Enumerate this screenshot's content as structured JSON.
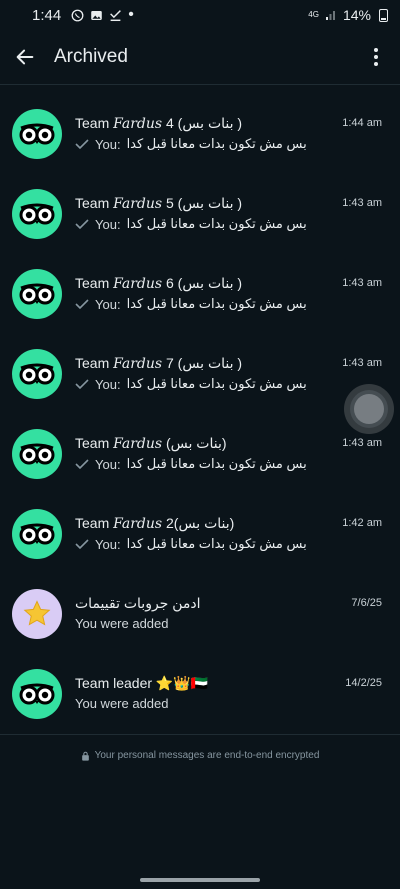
{
  "status_bar": {
    "time": "1:44",
    "network": "4G",
    "battery": "14%"
  },
  "header": {
    "title": "Archived"
  },
  "chats": [
    {
      "name_prefix": "Team ",
      "name_italic": "Fardus",
      "name_suffix": " 4 (بنات بس )",
      "time": "1:44 am",
      "you": "You:",
      "message": "بس مش تكون بدات معانا قبل كدا",
      "avatar": "owl-icon"
    },
    {
      "name_prefix": "Team ",
      "name_italic": "Fardus",
      "name_suffix": " 5 (بنات بس )",
      "time": "1:43 am",
      "you": "You:",
      "message": "بس مش تكون بدات معانا قبل كدا",
      "avatar": "owl-icon"
    },
    {
      "name_prefix": "Team ",
      "name_italic": "Fardus",
      "name_suffix": " 6 (بنات بس )",
      "time": "1:43 am",
      "you": "You:",
      "message": "بس مش تكون بدات معانا قبل كدا",
      "avatar": "owl-icon"
    },
    {
      "name_prefix": "Team ",
      "name_italic": "Fardus",
      "name_suffix": " 7 (بنات بس )",
      "time": "1:43 am",
      "you": "You:",
      "message": "بس مش تكون بدات معانا قبل كدا",
      "avatar": "owl-icon"
    },
    {
      "name_prefix": " Team ",
      "name_italic": "Fardus",
      "name_suffix": " (بنات بس)",
      "time": "1:43 am",
      "you": "You:",
      "message": "بس مش تكون بدات معانا قبل كدا",
      "avatar": "owl-icon"
    },
    {
      "name_prefix": "Team ",
      "name_italic": "Fardus",
      "name_suffix": " 2(بنات بس)",
      "time": "1:42 am",
      "you": "You:",
      "message": "بس مش تكون بدات معانا قبل كدا",
      "avatar": "owl-icon"
    }
  ],
  "chats_plain": [
    {
      "name": "ادمن جروبات تقييمات",
      "time": "7/6/25",
      "preview": "You were added",
      "avatar": "star-icon"
    },
    {
      "name": "Team leader ⭐👑🇦🇪",
      "time": "14/2/25",
      "preview": "You were added",
      "avatar": "owl-icon"
    }
  ],
  "footer": {
    "note": "Your personal messages are end-to-end encrypted"
  },
  "colors": {
    "background": "#0b141a",
    "avatar_green": "#34e0a1",
    "avatar_lavender": "#d9ccf5",
    "muted_text": "#8696a0"
  }
}
